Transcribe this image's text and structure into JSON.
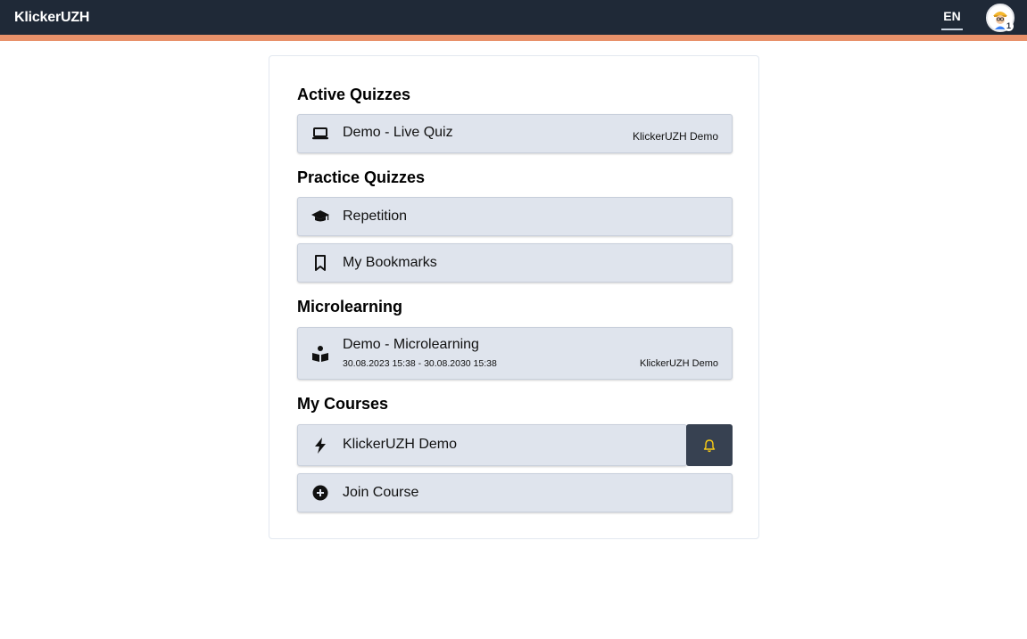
{
  "app": {
    "brand": "KlickerUZH",
    "language": "EN",
    "avatar_badge": "1"
  },
  "colors": {
    "topbar": "#1f2937",
    "accent": "#e8916a",
    "card": "#dfe4ed",
    "bell_bg": "#374151",
    "bell": "#facc15"
  },
  "sections": {
    "active": {
      "title": "Active Quizzes",
      "items": [
        {
          "label": "Demo - Live Quiz",
          "course": "KlickerUZH Demo",
          "icon": "laptop-icon"
        }
      ]
    },
    "practice": {
      "title": "Practice Quizzes",
      "items": [
        {
          "label": "Repetition",
          "icon": "graduation-cap-icon"
        },
        {
          "label": "My Bookmarks",
          "icon": "bookmark-icon"
        }
      ]
    },
    "microlearning": {
      "title": "Microlearning",
      "items": [
        {
          "label": "Demo - Microlearning",
          "dates": "30.08.2023 15:38 - 30.08.2030 15:38",
          "course": "KlickerUZH Demo",
          "icon": "book-reader-icon"
        }
      ]
    },
    "courses": {
      "title": "My Courses",
      "items": [
        {
          "label": "KlickerUZH Demo",
          "icon": "bolt-icon",
          "action_icon": "bell-icon"
        },
        {
          "label": "Join Course",
          "icon": "plus-circle-icon"
        }
      ]
    }
  }
}
